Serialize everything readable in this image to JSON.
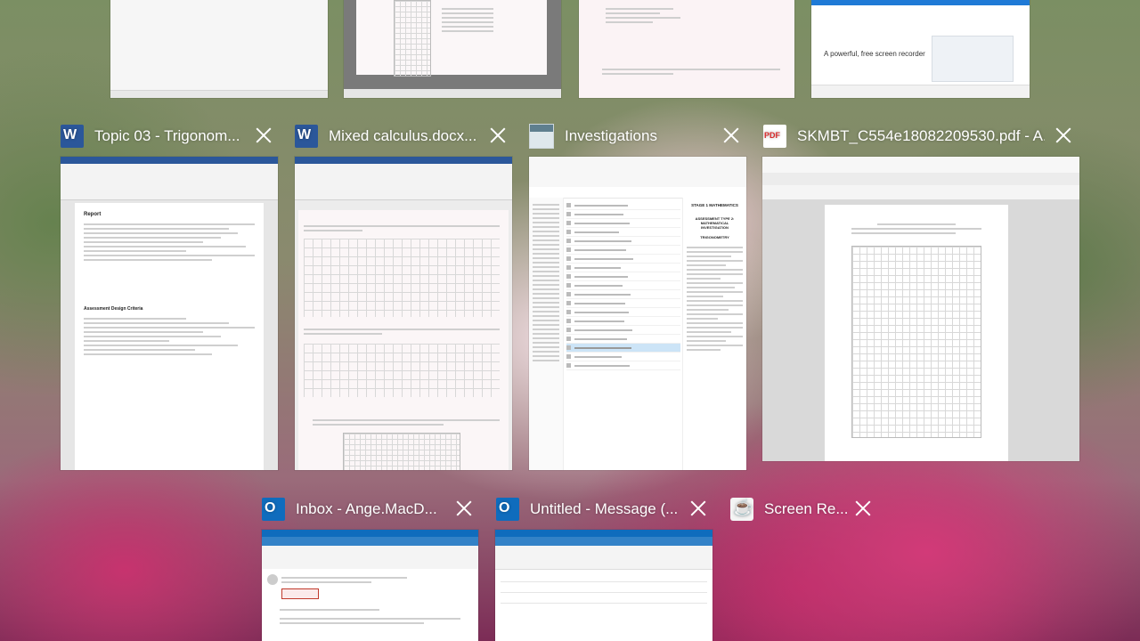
{
  "windows": [
    {
      "title": "Topic 03 - Trigonom...",
      "app_icon": "word-icon",
      "doc_heading": "Report",
      "doc_section": "Assessment Design Criteria"
    },
    {
      "title": "Mixed calculus.docx...",
      "app_icon": "word-icon"
    },
    {
      "title": "Investigations",
      "app_icon": "folder-icon",
      "preview_heading": "STAGE 1 MATHEMATICS",
      "preview_sub": "ASSESSMENT TYPE 2: MATHEMATICAL INVESTIGATION",
      "preview_topic": "TRIGONOMETRY"
    },
    {
      "title": "SKMBT_C554e18082209530.pdf - A...",
      "app_icon": "pdf-icon"
    },
    {
      "title": "Inbox - Ange.MacD...",
      "app_icon": "outlook-icon"
    },
    {
      "title": "Untitled - Message (...",
      "app_icon": "outlook-icon"
    },
    {
      "title": "Screen Re...",
      "app_icon": "java-icon"
    }
  ],
  "top_row": {
    "screen_recorder_heading": "A powerful, free screen recorder"
  },
  "colors": {
    "word": "#2b579a",
    "outlook": "#0f6cbd",
    "pdf": "#d92b2b"
  }
}
